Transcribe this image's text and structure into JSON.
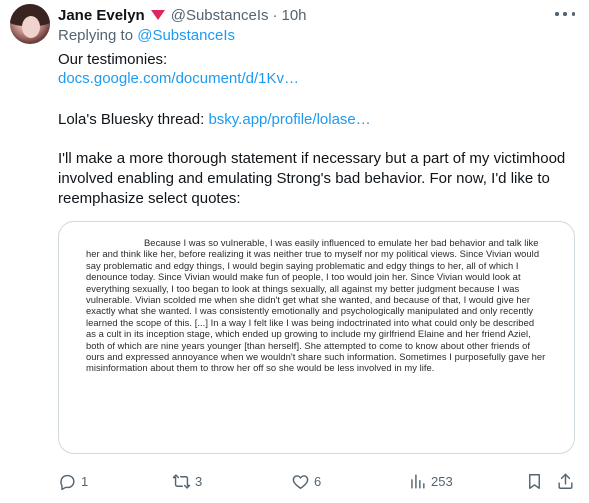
{
  "author": {
    "display_name": "Jane Evelyn",
    "handle": "@SubstanceIs",
    "separator": "·",
    "time": "10h"
  },
  "replying": {
    "prefix": "Replying to",
    "mention": "@SubstanceIs"
  },
  "body": {
    "line1": "Our testimonies:",
    "link1": "docs.google.com/document/d/1Kv…",
    "line3_prefix": "Lola's Bluesky thread: ",
    "link2": "bsky.app/profile/lolase…",
    "paragraph": "I'll make a more thorough statement if necessary but a part of my victimhood involved enabling and emulating Strong's bad behavior. For now, I'd like to reemphasize select quotes:"
  },
  "quote_image_text": "Because I was so vulnerable, I was easily influenced to emulate her bad behavior and talk like her and think like her, before realizing it was neither true to myself nor my political views. Since Vivian would say problematic and edgy things, I would begin saying problematic and edgy things to her, all of which I denounce today. Since Vivian would make fun of people, I too would join her. Since Vivian would look at everything sexually, I too began to look at things sexually, all against my better judgment because I was vulnerable. Vivian scolded me when she didn't get what she wanted, and because of that, I would give her exactly what she wanted. I was consistently emotionally and psychologically manipulated and only recently learned the scope of this. [...] In a way I felt like I was being indoctrinated into what could only be described as a cult in its inception stage, which ended up growing to include my girlfriend Elaine and her friend Aziel, both of which are nine years younger [than herself]. She attempted to come to know about other friends of ours and expressed annoyance when we wouldn't share such information. Sometimes I purposefully gave her misinformation about them to throw her off so she would be less involved in my life.",
  "actions": {
    "replies": "1",
    "reposts": "3",
    "likes": "6",
    "views": "253"
  },
  "icons": {
    "reply": "reply-icon",
    "repost": "repost-icon",
    "like": "heart-icon",
    "views": "views-chart-icon",
    "bookmark": "bookmark-icon",
    "share": "share-icon",
    "more": "more-dots-icon",
    "badge": "triangle-badge-icon"
  },
  "colors": {
    "link": "#1d9bf0",
    "secondary_text": "#536471",
    "badge": "#e0245e",
    "border": "#cfd9de"
  }
}
